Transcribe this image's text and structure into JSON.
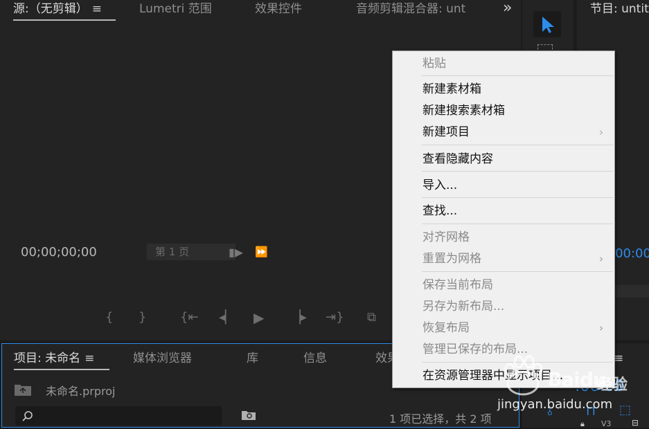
{
  "source_panel": {
    "tabs": [
      {
        "label": "源:（无剪辑）",
        "active": true
      },
      {
        "label": "Lumetri 范围"
      },
      {
        "label": "效果控件"
      },
      {
        "label": "音频剪辑混合器: unt"
      }
    ],
    "overflow_glyph": "»",
    "timecode": "00;00;00;00",
    "page_select": "第 1 页"
  },
  "program_panel": {
    "tab_label": "节目: untit",
    "timecode": ":00:00"
  },
  "project_panel": {
    "tabs": [
      {
        "label": "项目: 未命名",
        "active": true
      },
      {
        "label": "媒体浏览器"
      },
      {
        "label": "库"
      },
      {
        "label": "信息"
      },
      {
        "label": "效果"
      }
    ],
    "file_name": "未命名.prproj",
    "search_placeholder": "",
    "selection_status": "1 项已选择，共 2 项"
  },
  "timeline_panel": {
    "timecode": ":00:00",
    "track_label": "V3"
  },
  "context_menu": {
    "items": [
      {
        "label": "粘贴",
        "enabled": false
      },
      {
        "label": "新建素材箱",
        "enabled": true
      },
      {
        "label": "新建搜索素材箱",
        "enabled": true
      },
      {
        "label": "新建项目",
        "enabled": true,
        "submenu": true
      },
      {
        "label": "查看隐藏内容",
        "enabled": true
      },
      {
        "label": "导入...",
        "enabled": true
      },
      {
        "label": "查找...",
        "enabled": true
      },
      {
        "label": "对齐网格",
        "enabled": false
      },
      {
        "label": "重置为网格",
        "enabled": false,
        "submenu": true
      },
      {
        "label": "保存当前布局",
        "enabled": false
      },
      {
        "label": "另存为新布局...",
        "enabled": false
      },
      {
        "label": "恢复布局",
        "enabled": false,
        "submenu": true
      },
      {
        "label": "管理已保存的布局...",
        "enabled": false
      },
      {
        "label": "在资源管理器中显示项目...",
        "enabled": true
      }
    ]
  },
  "watermark": {
    "brand": "Baidu",
    "brand_suffix": "经验",
    "url": "jingyan.baidu.com"
  },
  "colors": {
    "accent_blue": "#2d8ceb",
    "panel_bg": "#232323",
    "menu_bg": "#f0f0f0"
  }
}
